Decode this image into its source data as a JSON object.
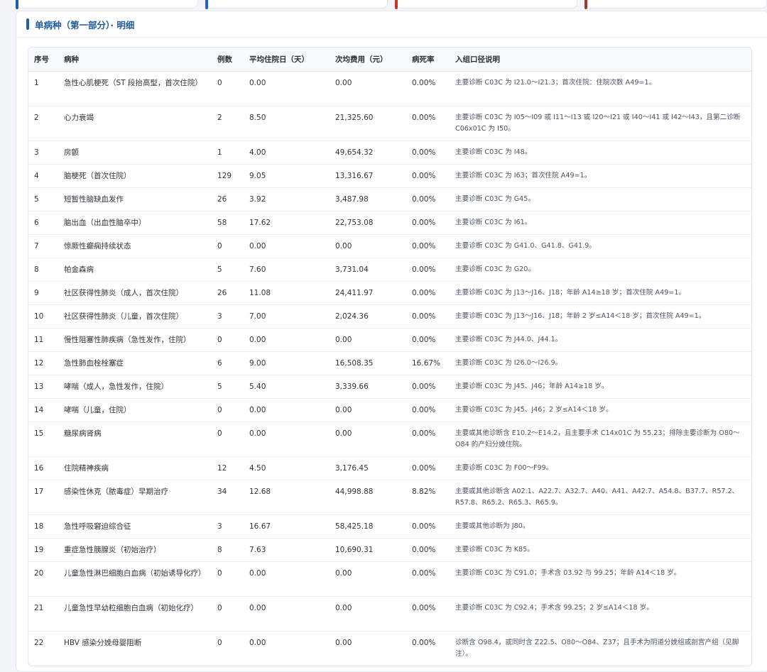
{
  "top_cards": [
    {
      "accent": "#1f5fa8"
    },
    {
      "accent": "#2a5fc7"
    },
    {
      "accent": "#c0392b"
    },
    {
      "accent": "#b03030"
    }
  ],
  "section": {
    "title": "单病种（第一部分）· 明细"
  },
  "table": {
    "headers": [
      "序号",
      "病种",
      "例数",
      "平均住院日（天）",
      "次均费用（元）",
      "病死率",
      "入组口径说明"
    ],
    "rows": [
      {
        "no": "1",
        "name": "急性心肌梗死（ST 段抬高型，首次住院）",
        "cases": "0",
        "los": "0.00",
        "cost": "0.00",
        "mortality": "0.00%",
        "note": "主要诊断 C03C 为 I21.0～I21.3；首次住院：住院次数 A49=1。",
        "lines": 2
      },
      {
        "no": "2",
        "name": "心力衰竭",
        "cases": "2",
        "los": "8.50",
        "cost": "21,325.60",
        "mortality": "0.00%",
        "note": "主要诊断 C03C 为 I05～I09 或 I11～I13 或 I20～I21 或 I40～I41 或 I42～I43，且第二诊断 C06x01C 为 I50。",
        "lines": 2
      },
      {
        "no": "3",
        "name": "房颤",
        "cases": "1",
        "los": "4.00",
        "cost": "49,654.32",
        "mortality": "0.00%",
        "note": "主要诊断 C03C 为 I48。",
        "lines": 1
      },
      {
        "no": "4",
        "name": "脑梗死（首次住院）",
        "cases": "129",
        "los": "9.05",
        "cost": "13,316.67",
        "mortality": "0.00%",
        "note": "主要诊断 C03C 为 I63；首次住院 A49=1。",
        "lines": 1
      },
      {
        "no": "5",
        "name": "短暂性脑缺血发作",
        "cases": "26",
        "los": "3.92",
        "cost": "3,487.98",
        "mortality": "0.00%",
        "note": "主要诊断 C03C 为 G45。",
        "lines": 1
      },
      {
        "no": "6",
        "name": "脑出血（出血性脑卒中）",
        "cases": "58",
        "los": "17.62",
        "cost": "22,753.08",
        "mortality": "0.00%",
        "note": "主要诊断 C03C 为 I61。",
        "lines": 1
      },
      {
        "no": "7",
        "name": "惊厥性癫痫持续状态",
        "cases": "0",
        "los": "0.00",
        "cost": "0.00",
        "mortality": "0.00%",
        "note": "主要诊断 C03C 为 G41.0、G41.8、G41.9。",
        "lines": 1
      },
      {
        "no": "8",
        "name": "帕金森病",
        "cases": "5",
        "los": "7.60",
        "cost": "3,731.04",
        "mortality": "0.00%",
        "note": "主要诊断 C03C 为 G20。",
        "lines": 1
      },
      {
        "no": "9",
        "name": "社区获得性肺炎（成人，首次住院）",
        "cases": "26",
        "los": "11.08",
        "cost": "24,411.97",
        "mortality": "0.00%",
        "note": "主要诊断 C03C 为 J13～J16、J18；年龄 A14≥18 岁；首次住院 A49=1。",
        "lines": 1
      },
      {
        "no": "10",
        "name": "社区获得性肺炎（儿童，首次住院）",
        "cases": "3",
        "los": "7.00",
        "cost": "2,024.36",
        "mortality": "0.00%",
        "note": "主要诊断 C03C 为 J13～J16、J18；年龄 2 岁≤A14＜18 岁；首次住院 A49=1。",
        "lines": 1
      },
      {
        "no": "11",
        "name": "慢性阻塞性肺疾病（急性发作，住院）",
        "cases": "0",
        "los": "0.00",
        "cost": "0.00",
        "mortality": "0.00%",
        "note": "主要诊断 C03C 为 J44.0、J44.1。",
        "lines": 1
      },
      {
        "no": "12",
        "name": "急性肺血栓栓塞症",
        "cases": "6",
        "los": "9.00",
        "cost": "16,508.35",
        "mortality": "16.67%",
        "note": "主要诊断 C03C 为 I26.0～I26.9。",
        "lines": 1
      },
      {
        "no": "13",
        "name": "哮喘（成人，急性发作，住院）",
        "cases": "5",
        "los": "5.40",
        "cost": "3,339.66",
        "mortality": "0.00%",
        "note": "主要诊断 C03C 为 J45、J46；年龄 A14≥18 岁。",
        "lines": 1
      },
      {
        "no": "14",
        "name": "哮喘（儿童，住院）",
        "cases": "0",
        "los": "0.00",
        "cost": "0.00",
        "mortality": "0.00%",
        "note": "主要诊断 C03C 为 J45、J46；2 岁≤A14＜18 岁。",
        "lines": 1
      },
      {
        "no": "15",
        "name": "糖尿病肾病",
        "cases": "0",
        "los": "0.00",
        "cost": "0.00",
        "mortality": "0.00%",
        "note": "主要或其他诊断含 E10.2～E14.2，且主要手术 C14x01C 为 55.23；排除主要诊断为 O80～O84 的产妇分娩住院。",
        "lines": 2
      },
      {
        "no": "16",
        "name": "住院精神疾病",
        "cases": "12",
        "los": "4.50",
        "cost": "3,176.45",
        "mortality": "0.00%",
        "note": "主要诊断 C03C 为 F00～F99。",
        "lines": 1
      },
      {
        "no": "17",
        "name": "感染性休克（脓毒症）早期治疗",
        "cases": "34",
        "los": "12.68",
        "cost": "44,998.88",
        "mortality": "8.82%",
        "note": "主要或其他诊断含 A02.1、A22.7、A32.7、A40、A41、A42.7、A54.8、B37.7、R57.2、R57.8、R65.2、R65.3、R65.9。",
        "lines": 2
      },
      {
        "no": "18",
        "name": "急性呼吸窘迫综合征",
        "cases": "3",
        "los": "16.67",
        "cost": "58,425.18",
        "mortality": "0.00%",
        "note": "主要或其他诊断为 J80。",
        "lines": 1
      },
      {
        "no": "19",
        "name": "重症急性胰腺炎（初始治疗）",
        "cases": "8",
        "los": "7.63",
        "cost": "10,690.31",
        "mortality": "0.00%",
        "note": "主要诊断 C03C 为 K85。",
        "lines": 1
      },
      {
        "no": "20",
        "name": "儿童急性淋巴细胞白血病（初始诱导化疗）",
        "cases": "0",
        "los": "0.00",
        "cost": "0.00",
        "mortality": "0.00%",
        "note": "主要诊断 C03C 为 C91.0；手术含 03.92 与 99.25；年龄 A14＜18 岁。",
        "lines": 2
      },
      {
        "no": "21",
        "name": "儿童急性早幼粒细胞白血病（初始化疗）",
        "cases": "0",
        "los": "0.00",
        "cost": "0.00",
        "mortality": "0.00%",
        "note": "主要诊断 C03C 为 C92.4；手术含 99.25；2 岁≤A14＜18 岁。",
        "lines": 2
      },
      {
        "no": "22",
        "name": "HBV 感染分娩母婴阻断",
        "cases": "0",
        "los": "0.00",
        "cost": "0.00",
        "mortality": "0.00%",
        "note": "诊断含 O98.4，或同时含 Z22.5、O80～O84、Z37；且手术为阴道分娩组或剖宫产组（见脚注）。",
        "lines": 2
      }
    ]
  }
}
